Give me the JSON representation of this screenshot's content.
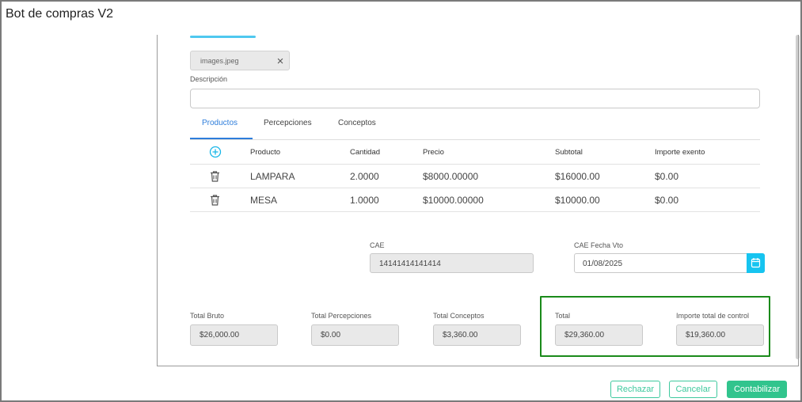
{
  "app": {
    "title": "Bot de compras V2"
  },
  "attachment": {
    "file_name": "images.jpeg"
  },
  "description": {
    "label": "Descripción",
    "value": ""
  },
  "tabs": [
    {
      "label": "Productos",
      "active": true
    },
    {
      "label": "Percepciones",
      "active": false
    },
    {
      "label": "Conceptos",
      "active": false
    }
  ],
  "table": {
    "headers": [
      "Producto",
      "Cantidad",
      "Precio",
      "Subtotal",
      "Importe exento"
    ],
    "rows": [
      {
        "producto": "LAMPARA",
        "cantidad": "2.0000",
        "precio": "$8000.00000",
        "subtotal": "$16000.00",
        "exento": "$0.00"
      },
      {
        "producto": "MESA",
        "cantidad": "1.0000",
        "precio": "$10000.00000",
        "subtotal": "$10000.00",
        "exento": "$0.00"
      }
    ]
  },
  "cae": {
    "label": "CAE",
    "value": "14141414141414"
  },
  "cae_fecha": {
    "label": "CAE Fecha Vto",
    "value": "01/08/2025"
  },
  "totals": {
    "bruto": {
      "label": "Total Bruto",
      "value": "$26,000.00"
    },
    "percepciones": {
      "label": "Total Percepciones",
      "value": "$0.00"
    },
    "conceptos": {
      "label": "Total Conceptos",
      "value": "$3,360.00"
    },
    "total": {
      "label": "Total",
      "value": "$29,360.00"
    },
    "control": {
      "label": "Importe total de control",
      "value": "$19,360.00"
    }
  },
  "actions": {
    "reject": "Rechazar",
    "cancel": "Cancelar",
    "post": "Contabilizar"
  },
  "colors": {
    "accent_blue": "#2d7ddb",
    "accent_green": "#31c48d",
    "highlight_border": "#1a8a1a",
    "calendar_button": "#16c4f0"
  },
  "icons": {
    "add": "plus-circle-icon",
    "delete": "trash-icon",
    "remove_file": "close-icon",
    "calendar": "calendar-icon"
  }
}
